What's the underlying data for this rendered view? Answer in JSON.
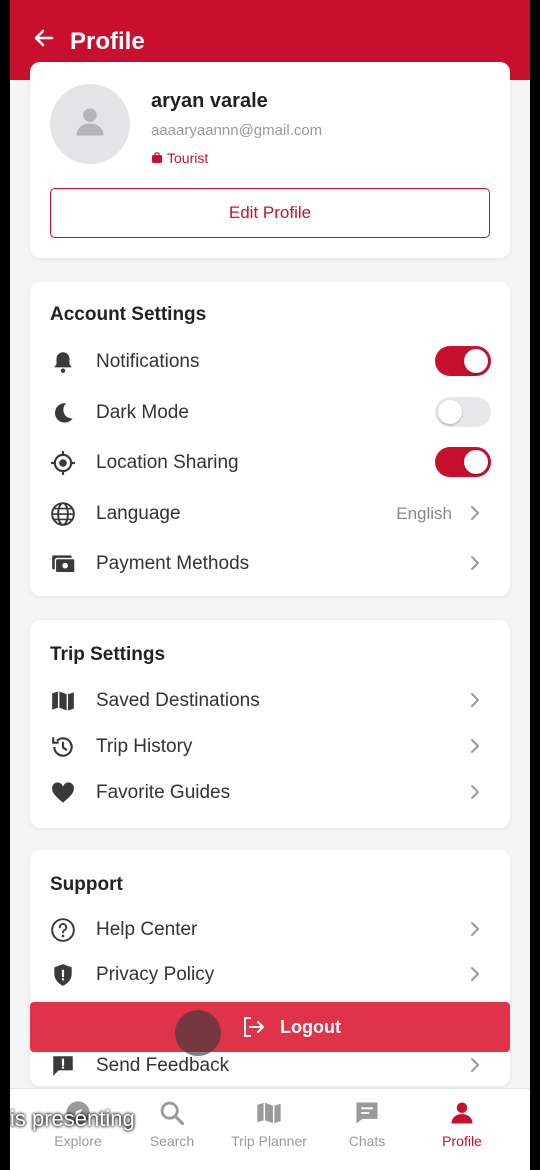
{
  "header": {
    "title": "Profile"
  },
  "profile": {
    "name": "aryan varale",
    "email": "aaaaryaannn@gmail.com",
    "role": "Tourist",
    "edit_label": "Edit Profile"
  },
  "account_settings": {
    "title": "Account Settings",
    "items": [
      {
        "label": "Notifications",
        "icon": "bell-icon",
        "toggle": "on"
      },
      {
        "label": "Dark Mode",
        "icon": "moon-icon",
        "toggle": "off"
      },
      {
        "label": "Location Sharing",
        "icon": "location-crosshair-icon",
        "toggle": "on"
      },
      {
        "label": "Language",
        "icon": "globe-icon",
        "value": "English"
      },
      {
        "label": "Payment Methods",
        "icon": "payment-icon"
      }
    ]
  },
  "trip_settings": {
    "title": "Trip Settings",
    "items": [
      {
        "label": "Saved Destinations",
        "icon": "map-icon"
      },
      {
        "label": "Trip History",
        "icon": "history-icon"
      },
      {
        "label": "Favorite Guides",
        "icon": "heart-icon"
      }
    ]
  },
  "support": {
    "title": "Support",
    "items": [
      {
        "label": "Help Center",
        "icon": "help-circle-icon"
      },
      {
        "label": "Privacy Policy",
        "icon": "shield-icon"
      },
      {
        "label": "Send Feedback",
        "icon": "feedback-icon"
      }
    ]
  },
  "logout_label": "Logout",
  "bottom_nav": [
    {
      "label": "Explore",
      "icon": "compass-icon"
    },
    {
      "label": "Search",
      "icon": "search-icon"
    },
    {
      "label": "Trip Planner",
      "icon": "map-icon"
    },
    {
      "label": "Chats",
      "icon": "chat-icon"
    },
    {
      "label": "Profile",
      "icon": "person-icon",
      "active": true
    }
  ],
  "caption": "is presenting",
  "colors": {
    "primary": "#c8102e",
    "logout": "#df3349",
    "background": "#f5f5f6"
  }
}
